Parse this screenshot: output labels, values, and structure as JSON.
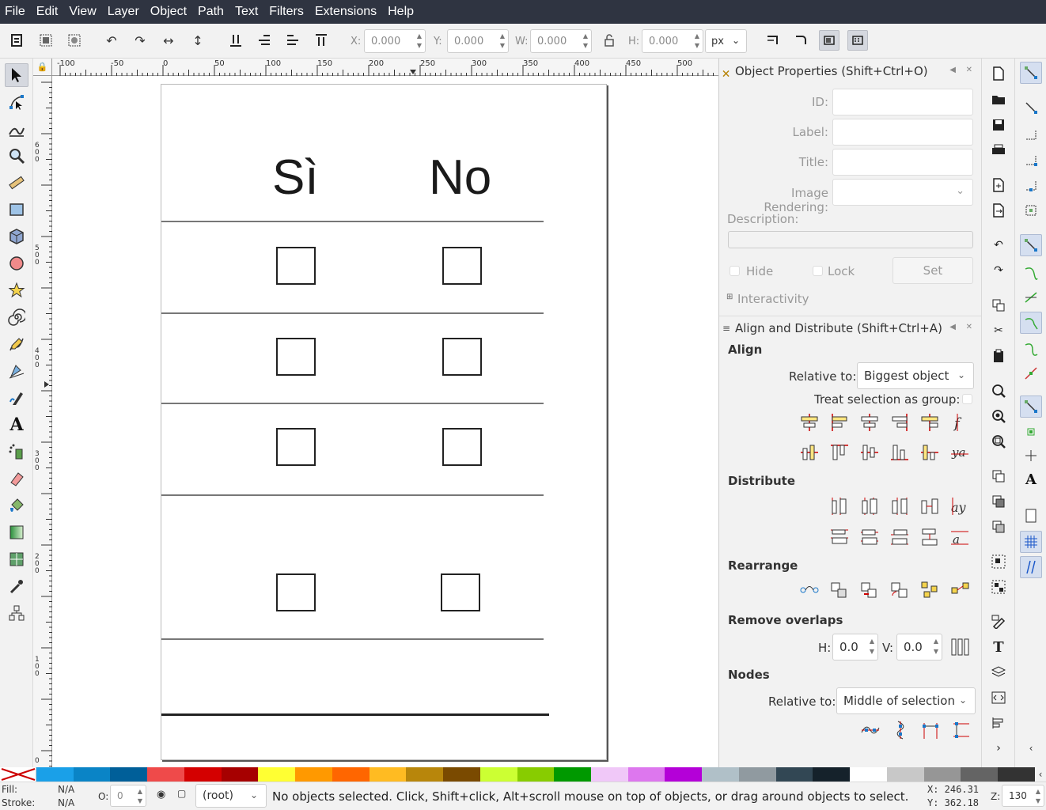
{
  "menu": [
    "File",
    "Edit",
    "View",
    "Layer",
    "Object",
    "Path",
    "Text",
    "Filters",
    "Extensions",
    "Help"
  ],
  "toolbar": {
    "x_label": "X:",
    "x_value": "0.000",
    "y_label": "Y:",
    "y_value": "0.000",
    "w_label": "W:",
    "w_value": "0.000",
    "h_label": "H:",
    "h_value": "0.000",
    "unit": "px"
  },
  "ruler": {
    "h_labels": [
      "-100",
      "-50",
      "0",
      "50",
      "100",
      "150",
      "200",
      "250",
      "300",
      "350",
      "400",
      "450",
      "500"
    ],
    "v_labels": [
      "6\n0\n0",
      "5\n0\n0",
      "4\n0\n0",
      "3\n0\n0",
      "2\n0\n0",
      "1\n0\n0",
      "0"
    ]
  },
  "page": {
    "col1": "Sì",
    "col2": "No"
  },
  "object_properties": {
    "title": "Object Properties (Shift+Ctrl+O)",
    "id_label": "ID:",
    "label_label": "Label:",
    "title_label": "Title:",
    "image_rendering_label": "Image Rendering:",
    "description_label": "Description:",
    "hide_label": "Hide",
    "lock_label": "Lock",
    "set_label": "Set",
    "interactivity_label": "Interactivity"
  },
  "align": {
    "title": "Align and Distribute (Shift+Ctrl+A)",
    "align_section": "Align",
    "relative_to_label": "Relative to:",
    "relative_to_value": "Biggest object",
    "treat_group_label": "Treat selection as group:",
    "distribute_section": "Distribute",
    "rearrange_section": "Rearrange",
    "remove_overlaps_section": "Remove overlaps",
    "h_label": "H:",
    "h_value": "0.0",
    "v_label": "V:",
    "v_value": "0.0",
    "nodes_section": "Nodes",
    "nodes_relative_label": "Relative to:",
    "nodes_relative_value": "Middle of selection"
  },
  "palette": [
    "#1aa0e8",
    "#0a84c6",
    "#005f99",
    "#ef4a4a",
    "#d40000",
    "#a60000",
    "#ffff33",
    "#ff9900",
    "#ff6600",
    "#ffbb22",
    "#b8860b",
    "#7a4a00",
    "#ccff33",
    "#88cc00",
    "#009900",
    "#f0c8f8",
    "#dd77ee",
    "#b400d8",
    "#b0c0c8",
    "#909aa0",
    "#324754",
    "#15222b",
    "#ffffff",
    "#c8c8c8",
    "#969696",
    "#646464",
    "#333333"
  ],
  "status": {
    "fill_label": "Fill:",
    "fill_value": "N/A",
    "stroke_label": "Stroke:",
    "stroke_value": "N/A",
    "opacity_label": "O:",
    "opacity_value": "0",
    "layer": "(root)",
    "message": "No objects selected. Click, Shift+click, Alt+scroll mouse on top of objects, or drag around objects to select.",
    "x_coord": "X: 246.31",
    "y_coord": "Y: 362.18",
    "zoom_label": "Z:",
    "zoom_value": "130"
  }
}
